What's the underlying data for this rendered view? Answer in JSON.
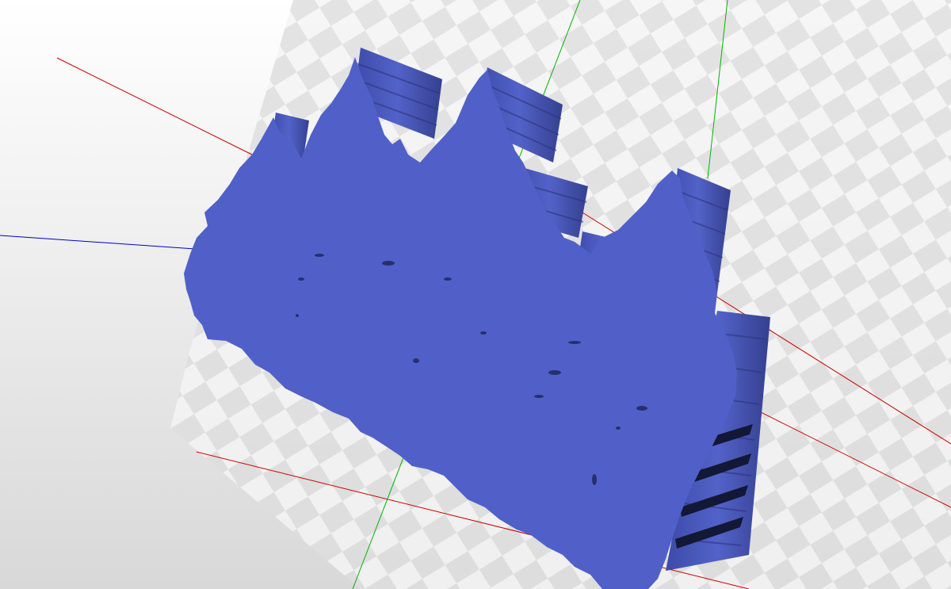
{
  "viewport": {
    "background_top": "#ffffff",
    "background_bottom": "#d8d8d8",
    "plate_light": "#f1f1f1",
    "plate_dark": "#dcdcdc"
  },
  "axes": {
    "x_color": "#cc0000",
    "y_color": "#00b300",
    "z_color": "#0000cc"
  },
  "model": {
    "shape": "forest-silhouette-extrusion",
    "color": "#5060c8",
    "shadow_color": "#2a347a",
    "tree_count": 7
  }
}
